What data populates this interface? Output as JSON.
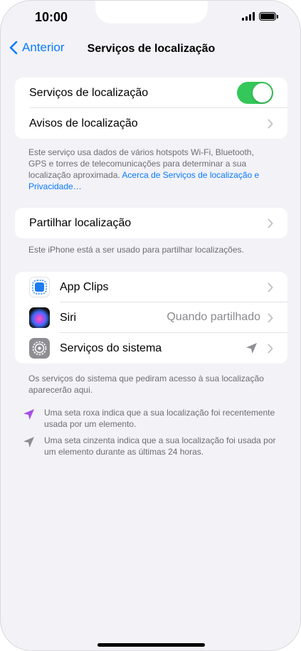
{
  "status": {
    "time": "10:00"
  },
  "nav": {
    "back_label": "Anterior",
    "title": "Serviços de localização"
  },
  "group1": {
    "location_services_label": "Serviços de localização",
    "location_services_on": true,
    "location_alerts_label": "Avisos de localização"
  },
  "footer1": {
    "text": "Este serviço usa dados de vários hotspots Wi-Fi, Bluetooth, GPS e torres de telecomunicações para determinar a sua localização aproximada.",
    "link": "Acerca de Serviços de localização e Privacidade…"
  },
  "group2": {
    "share_location_label": "Partilhar localização"
  },
  "footer2": {
    "text": "Este iPhone está a ser usado para partilhar localizações."
  },
  "apps": [
    {
      "label": "App Clips",
      "icon": "app-clips-icon",
      "value": ""
    },
    {
      "label": "Siri",
      "icon": "siri-icon",
      "value": "Quando partilhado"
    },
    {
      "label": "Serviços do sistema",
      "icon": "settings-gear-icon",
      "value": ""
    }
  ],
  "footer3": {
    "text": "Os serviços do sistema que pediram acesso à sua localização aparecerão aqui."
  },
  "legend": [
    {
      "icon": "purple-location-arrow-icon",
      "color": "#a550e6",
      "text": "Uma seta roxa indica que a sua localização foi recentemente usada por um elemento."
    },
    {
      "icon": "gray-location-arrow-icon",
      "color": "#8e8e93",
      "text": "Uma seta cinzenta indica que a sua localização foi usada por um elemento durante as últimas 24 horas."
    }
  ],
  "colors": {
    "accent": "#0a7aff",
    "toggle_on": "#34c759",
    "background": "#f2f2f7"
  }
}
